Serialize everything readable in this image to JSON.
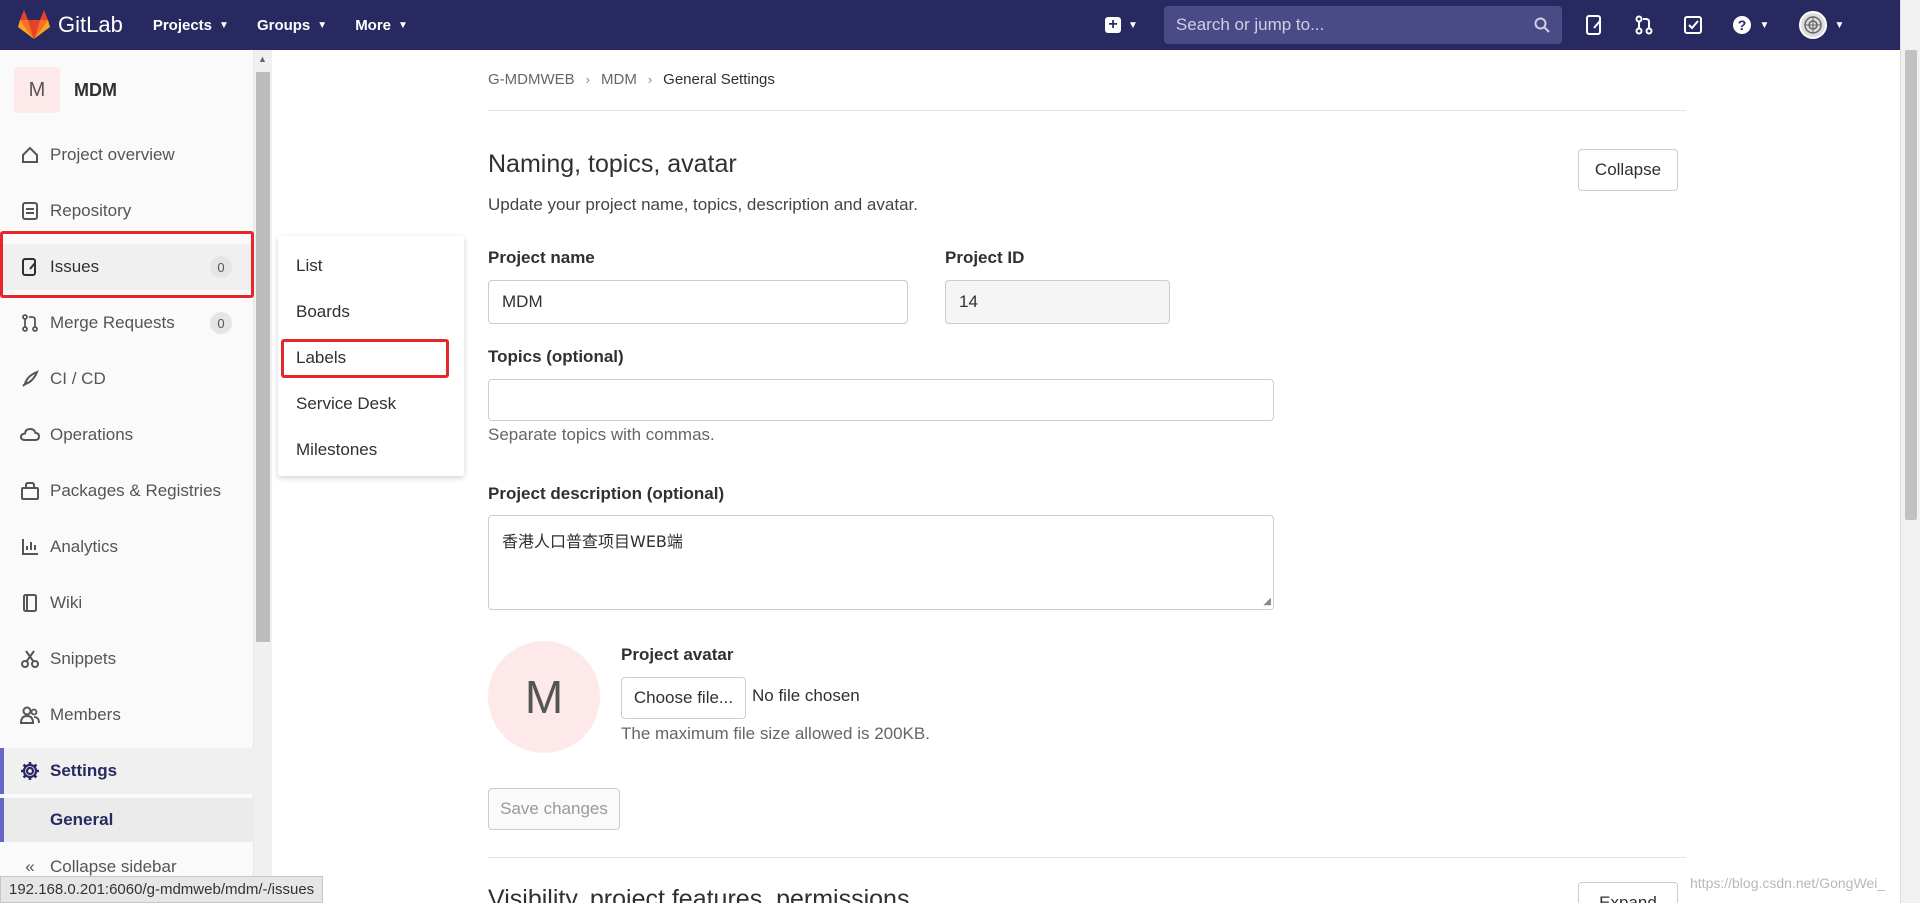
{
  "navbar": {
    "logo_text": "GitLab",
    "menu": [
      "Projects",
      "Groups",
      "More"
    ],
    "search_placeholder": "Search or jump to...",
    "colors": {
      "background": "#292961",
      "search": "#4a4a86"
    },
    "icons": [
      "plus-square-icon",
      "issues-icon",
      "merge-request-icon",
      "todo-icon",
      "help-icon",
      "user-avatar-icon"
    ]
  },
  "sidebar": {
    "project_avatar_letter": "M",
    "project_name": "MDM",
    "items": [
      {
        "label": "Project overview",
        "icon": "home-icon"
      },
      {
        "label": "Repository",
        "icon": "document-icon"
      },
      {
        "label": "Issues",
        "icon": "issues-icon",
        "badge": "0"
      },
      {
        "label": "Merge Requests",
        "icon": "merge-request-icon",
        "badge": "0"
      },
      {
        "label": "CI / CD",
        "icon": "rocket-icon"
      },
      {
        "label": "Operations",
        "icon": "cloud-icon"
      },
      {
        "label": "Packages & Registries",
        "icon": "package-icon"
      },
      {
        "label": "Analytics",
        "icon": "chart-icon"
      },
      {
        "label": "Wiki",
        "icon": "book-icon"
      },
      {
        "label": "Snippets",
        "icon": "scissors-icon"
      },
      {
        "label": "Members",
        "icon": "users-icon"
      },
      {
        "label": "Settings",
        "icon": "gear-icon"
      }
    ],
    "sub_item": "General",
    "collapse_label": "Collapse sidebar"
  },
  "flyout": {
    "items": [
      "List",
      "Boards",
      "Labels",
      "Service Desk",
      "Milestones"
    ]
  },
  "breadcrumb": [
    "G-MDMWEB",
    "MDM",
    "General Settings"
  ],
  "section": {
    "title": "Naming, topics, avatar",
    "description": "Update your project name, topics, description and avatar.",
    "collapse_button": "Collapse"
  },
  "form": {
    "project_name_label": "Project name",
    "project_name_value": "MDM",
    "project_id_label": "Project ID",
    "project_id_value": "14",
    "topics_label": "Topics (optional)",
    "topics_value": "",
    "topics_help": "Separate topics with commas.",
    "description_label": "Project description (optional)",
    "description_value": "香港人口普查项目WEB端",
    "avatar_label": "Project avatar",
    "avatar_letter": "M",
    "choose_file_button": "Choose file...",
    "no_file_text": "No file chosen",
    "max_size_help": "The maximum file size allowed is 200KB.",
    "save_button": "Save changes"
  },
  "next_section": {
    "title": "Visibility, project features, permissions",
    "button": "Expand"
  },
  "status_bar": "192.168.0.201:6060/g-mdmweb/mdm/-/issues",
  "watermark": "https://blog.csdn.net/GongWei_"
}
